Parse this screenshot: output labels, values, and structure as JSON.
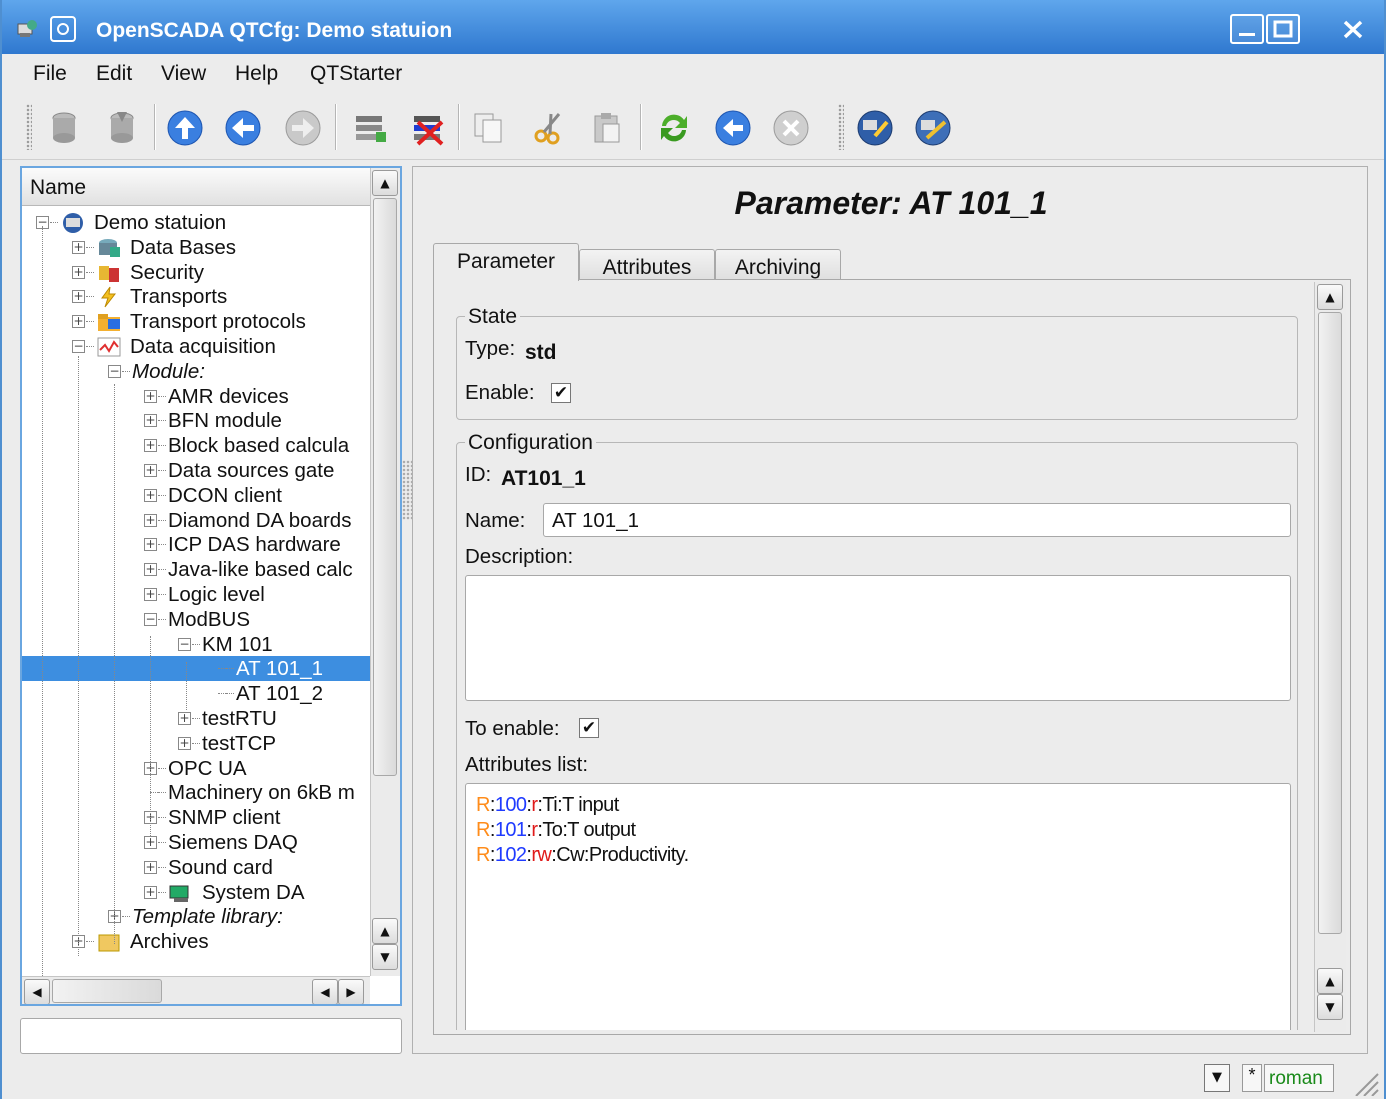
{
  "window": {
    "title": "OpenSCADA QTCfg: Demo statuion"
  },
  "menu": [
    "File",
    "Edit",
    "View",
    "Help",
    "QTStarter"
  ],
  "toolbar": {
    "icons": [
      "db-load-icon",
      "db-save-icon",
      "up-icon",
      "back-icon",
      "forward-icon",
      "add-item-icon",
      "delete-item-icon",
      "copy-icon",
      "cut-icon",
      "paste-icon",
      "refresh-icon",
      "start-icon",
      "stop-icon",
      "station-connect-icon",
      "station-config-icon"
    ]
  },
  "tree": {
    "header": "Name",
    "items": [
      {
        "label": "Demo statuion",
        "level": 0,
        "exp": "-"
      },
      {
        "label": "Data Bases",
        "level": 1,
        "exp": "+"
      },
      {
        "label": "Security",
        "level": 1,
        "exp": "+"
      },
      {
        "label": "Transports",
        "level": 1,
        "exp": "+"
      },
      {
        "label": "Transport protocols",
        "level": 1,
        "exp": "+"
      },
      {
        "label": "Data acquisition",
        "level": 1,
        "exp": "-"
      },
      {
        "label": "Module:",
        "level": 2,
        "exp": "-"
      },
      {
        "label": "AMR devices",
        "level": 3,
        "exp": "+"
      },
      {
        "label": "BFN module",
        "level": 3,
        "exp": "+"
      },
      {
        "label": "Block based calcula",
        "level": 3,
        "exp": "+"
      },
      {
        "label": "Data sources gate",
        "level": 3,
        "exp": "+"
      },
      {
        "label": "DCON client",
        "level": 3,
        "exp": "+"
      },
      {
        "label": "Diamond DA boards",
        "level": 3,
        "exp": "+"
      },
      {
        "label": "ICP DAS hardware",
        "level": 3,
        "exp": "+"
      },
      {
        "label": "Java-like based calc",
        "level": 3,
        "exp": "+"
      },
      {
        "label": "Logic level",
        "level": 3,
        "exp": "+"
      },
      {
        "label": "ModBUS",
        "level": 3,
        "exp": "-"
      },
      {
        "label": "KM 101",
        "level": 4,
        "exp": "-"
      },
      {
        "label": "AT 101_1",
        "level": 5,
        "exp": ""
      },
      {
        "label": "AT 101_2",
        "level": 5,
        "exp": ""
      },
      {
        "label": "testRTU",
        "level": 4,
        "exp": "+"
      },
      {
        "label": "testTCP",
        "level": 4,
        "exp": "+"
      },
      {
        "label": "OPC UA",
        "level": 3,
        "exp": "+"
      },
      {
        "label": "Machinery on 6kB m",
        "level": 3,
        "exp": ""
      },
      {
        "label": "SNMP client",
        "level": 3,
        "exp": "+"
      },
      {
        "label": "Siemens DAQ",
        "level": 3,
        "exp": "+"
      },
      {
        "label": "Sound card",
        "level": 3,
        "exp": "+"
      },
      {
        "label": "System DA",
        "level": 3,
        "exp": "+"
      },
      {
        "label": "Template library:",
        "level": 2,
        "exp": "+"
      },
      {
        "label": "Archives",
        "level": 1,
        "exp": "+"
      }
    ],
    "selected": "AT 101_1"
  },
  "page": {
    "title": "Parameter: AT 101_1",
    "tabs": [
      "Parameter",
      "Attributes",
      "Archiving"
    ],
    "active_tab": "Parameter",
    "state": {
      "group_label": "State",
      "type_label": "Type:",
      "type_value": "std",
      "enable_label": "Enable:",
      "enable_checked": true
    },
    "config": {
      "group_label": "Configuration",
      "id_label": "ID:",
      "id_value": "AT101_1",
      "name_label": "Name:",
      "name_value": "AT 101_1",
      "description_label": "Description:",
      "description_value": "",
      "to_enable_label": "To enable:",
      "to_enable_checked": true,
      "attributes_label": "Attributes list:",
      "attributes": [
        {
          "r": "R",
          "addr": "100",
          "mode": "r",
          "rest": "Ti:T input"
        },
        {
          "r": "R",
          "addr": "101",
          "mode": "r",
          "rest": "To:T output"
        },
        {
          "r": "R",
          "addr": "102",
          "mode": "rw",
          "rest": "Cw:Productivity."
        }
      ]
    }
  },
  "statusbar": {
    "star": "*",
    "user": "roman"
  },
  "colors": {
    "accent": "#3d8ee0",
    "title_bar": "#2f78cf",
    "attr_reg": "#ff8c1a",
    "attr_addr": "#1f3bff",
    "attr_mode": "#e01a1a",
    "user": "#1a8a1a"
  }
}
